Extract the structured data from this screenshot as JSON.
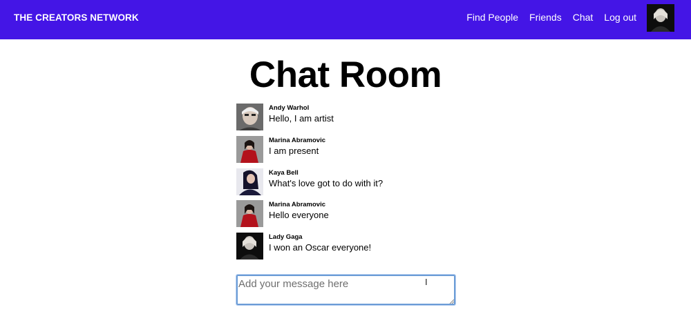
{
  "navbar": {
    "brand": "THE CREATORS NETWORK",
    "links": [
      "Find People",
      "Friends",
      "Chat",
      "Log out"
    ],
    "bg_color": "#4415e6",
    "avatar_icon": "user-avatar"
  },
  "chat": {
    "title": "Chat Room",
    "messages": [
      {
        "author": "Andy Warhol",
        "text": "Hello, I am artist"
      },
      {
        "author": "Marina Abramovic",
        "text": "I am present"
      },
      {
        "author": "Kaya Bell",
        "text": "What's love got to do with it?"
      },
      {
        "author": "Marina Abramovic",
        "text": "Hello everyone"
      },
      {
        "author": "Lady Gaga",
        "text": "I won an Oscar everyone!"
      }
    ],
    "composer": {
      "placeholder": "Add your message here",
      "value": ""
    }
  }
}
